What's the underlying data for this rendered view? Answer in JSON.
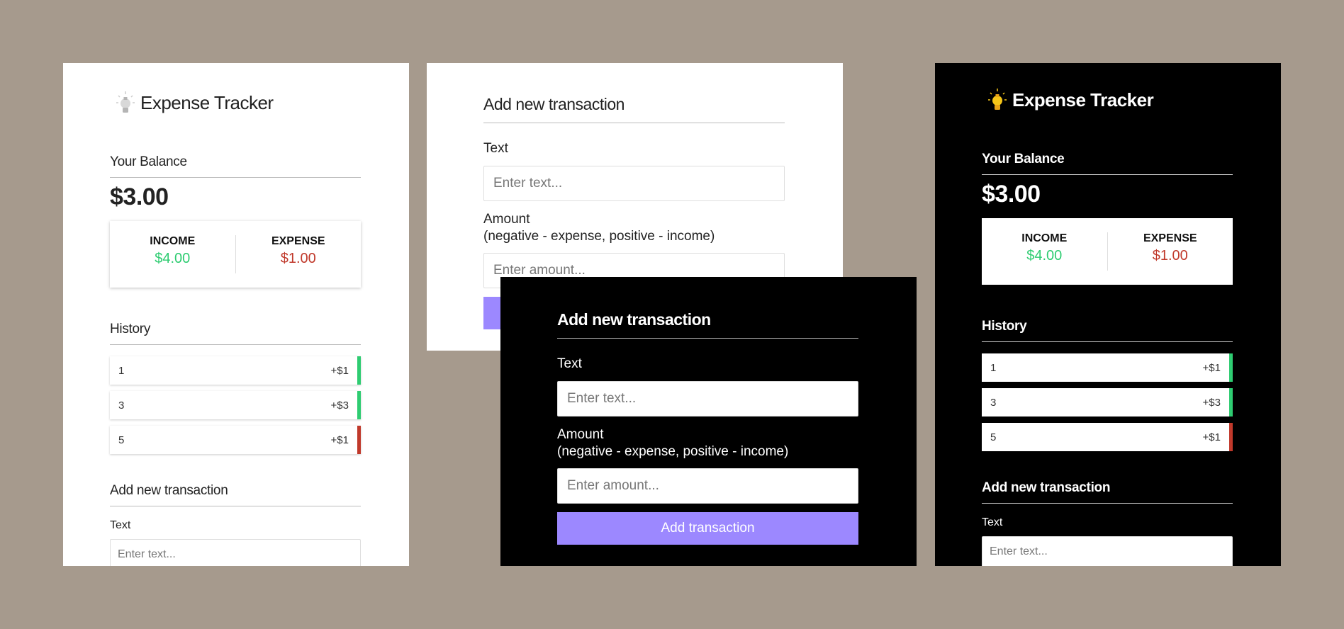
{
  "app": {
    "title": "Expense Tracker"
  },
  "balance": {
    "heading": "Your Balance",
    "value": "$3.00"
  },
  "summary": {
    "income_label": "INCOME",
    "income_value": "$4.00",
    "expense_label": "EXPENSE",
    "expense_value": "$1.00"
  },
  "history": {
    "heading": "History",
    "items": [
      {
        "text": "1",
        "amount": "+$1",
        "type": "plus"
      },
      {
        "text": "3",
        "amount": "+$3",
        "type": "plus"
      },
      {
        "text": "5",
        "amount": "+$1",
        "type": "minus"
      }
    ]
  },
  "form": {
    "heading": "Add new transaction",
    "text_label": "Text",
    "text_placeholder": "Enter text...",
    "amount_label": "Amount",
    "amount_hint": "(negative - expense, positive - income)",
    "amount_placeholder": "Enter amount...",
    "submit_label": "Add transaction"
  },
  "colors": {
    "background": "#a69a8d",
    "plus": "#2ecc71",
    "minus": "#c0392b",
    "button": "#9c88ff",
    "bulb_on": "#f5c518",
    "bulb_off": "#d8d8d8"
  },
  "icons": {
    "bulb_off": "lightbulb-off-icon",
    "bulb_on": "lightbulb-on-icon"
  }
}
